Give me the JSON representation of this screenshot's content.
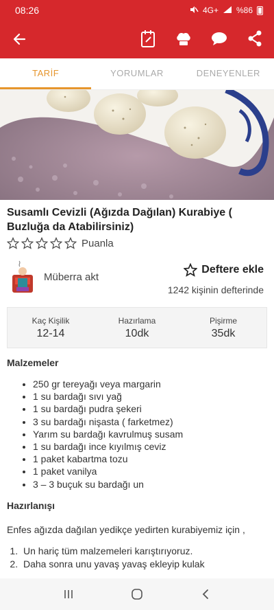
{
  "status": {
    "time": "08:26",
    "battery": "%86",
    "network": "4G+"
  },
  "tabs": [
    "TARİF",
    "YORUMLAR",
    "DENEYENLER"
  ],
  "recipe": {
    "title": "Susamlı Cevizli (Ağızda Dağılan) Kurabiye ( Buzluğa da Atabilirsiniz)",
    "rating_label": "Puanla",
    "rating": 0
  },
  "author": {
    "name": "Müberra akt"
  },
  "save": {
    "label": "Deftere ekle",
    "count": "1242 kişinin defterinde"
  },
  "stats": [
    {
      "label": "Kaç Kişilik",
      "value": "12-14"
    },
    {
      "label": "Hazırlama",
      "value": "10dk"
    },
    {
      "label": "Pişirme",
      "value": "35dk"
    }
  ],
  "ingredients": {
    "heading": "Malzemeler",
    "items": [
      "250 gr tereyağı veya margarin",
      "1 su bardağı sıvı yağ",
      "1 su bardağı pudra şekeri",
      "3 su bardağı nişasta ( farketmez)",
      "Yarım su bardağı kavrulmuş susam",
      "1 su bardağı ince kıyılmış ceviz",
      "1 paket kabartma tozu",
      "1 paket vanilya",
      "3 – 3 buçuk su bardağı un"
    ]
  },
  "preparation": {
    "heading": "Hazırlanışı",
    "intro": "Enfes ağızda dağılan yedikçe yedirten kurabiyemiz için ,",
    "steps": [
      "Un hariç tüm malzemeleri karıştırıyoruz.",
      "Daha sonra unu yavaş yavaş ekleyip kulak"
    ]
  },
  "colors": {
    "brand": "#d6282c",
    "accent": "#e6952c"
  },
  "icons": {
    "appbar": [
      "back-arrow-icon",
      "notebook-icon",
      "chef-hat-icon",
      "comment-icon",
      "share-icon"
    ],
    "navbar": [
      "recent-apps-icon",
      "home-icon",
      "back-icon"
    ]
  }
}
